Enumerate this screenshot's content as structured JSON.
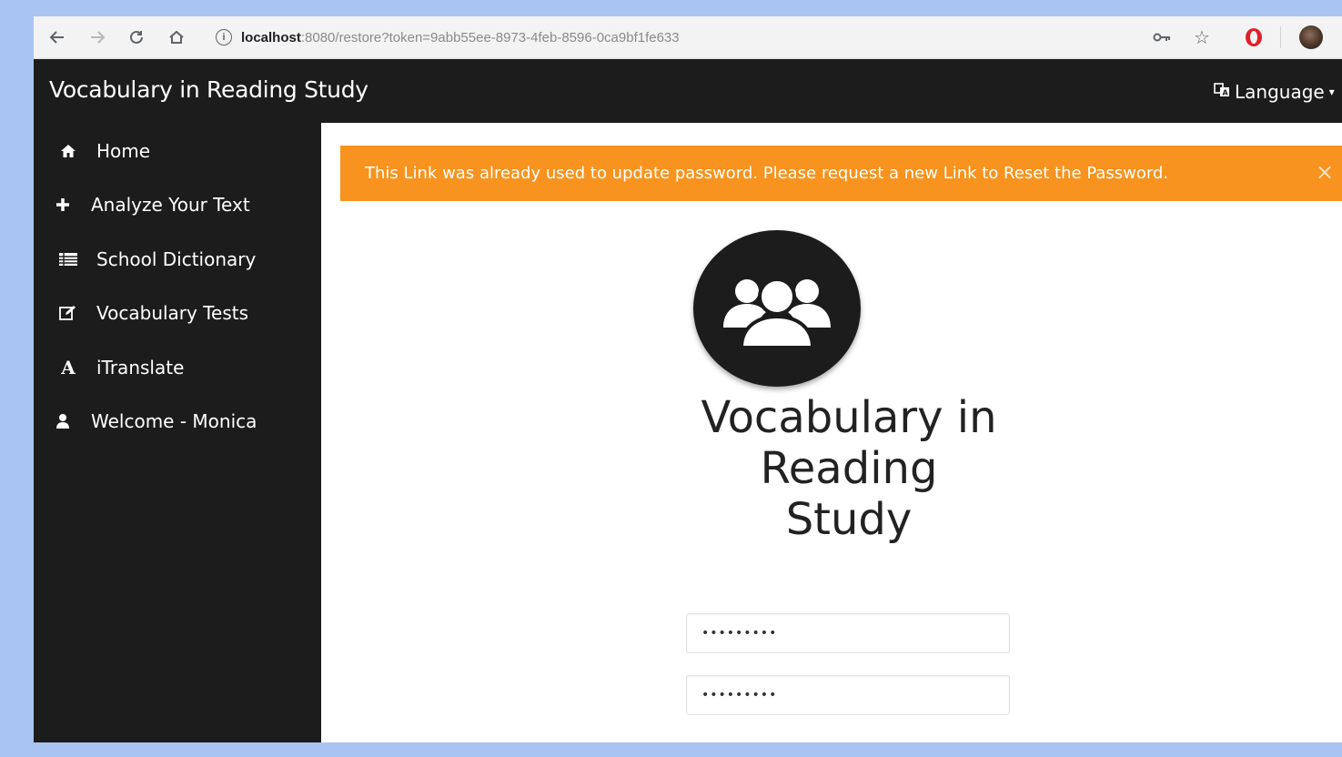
{
  "browser": {
    "url_host": "localhost",
    "url_rest": ":8080/restore?token=9abb55ee-8973-4feb-8596-0ca9bf1fe633",
    "icons": [
      "back-arrow-icon",
      "forward-arrow-icon",
      "reload-icon",
      "home-icon",
      "info-icon",
      "key-icon",
      "star-icon",
      "opera-icon",
      "profile-avatar-icon"
    ]
  },
  "header": {
    "brand": "Vocabulary in Reading Study",
    "language_label": "Language"
  },
  "sidebar": {
    "items": [
      {
        "label": "Home",
        "icon": "home-icon"
      },
      {
        "label": "Analyze Your Text",
        "icon": "plus-icon"
      },
      {
        "label": "School Dictionary",
        "icon": "list-icon"
      },
      {
        "label": "Vocabulary Tests",
        "icon": "edit-icon"
      },
      {
        "label": "iTranslate",
        "icon": "font-icon"
      },
      {
        "label": "Welcome - Monica",
        "icon": "user-icon"
      }
    ]
  },
  "alert": {
    "message": "This Link was already used to update password. Please request a new Link to Reset the Password.",
    "close": "×",
    "color": "#f7931e"
  },
  "main": {
    "logo_icon": "users-group-icon",
    "title_line1": "Vocabulary in",
    "title_line2": "Reading",
    "title_line3": "Study",
    "password_value": "•••••••••",
    "confirm_value": "•••••••••"
  },
  "colors": {
    "sidebar_bg": "#1c1c1c",
    "alert_bg": "#f7931e",
    "frame_bg": "#a9c4f1"
  }
}
